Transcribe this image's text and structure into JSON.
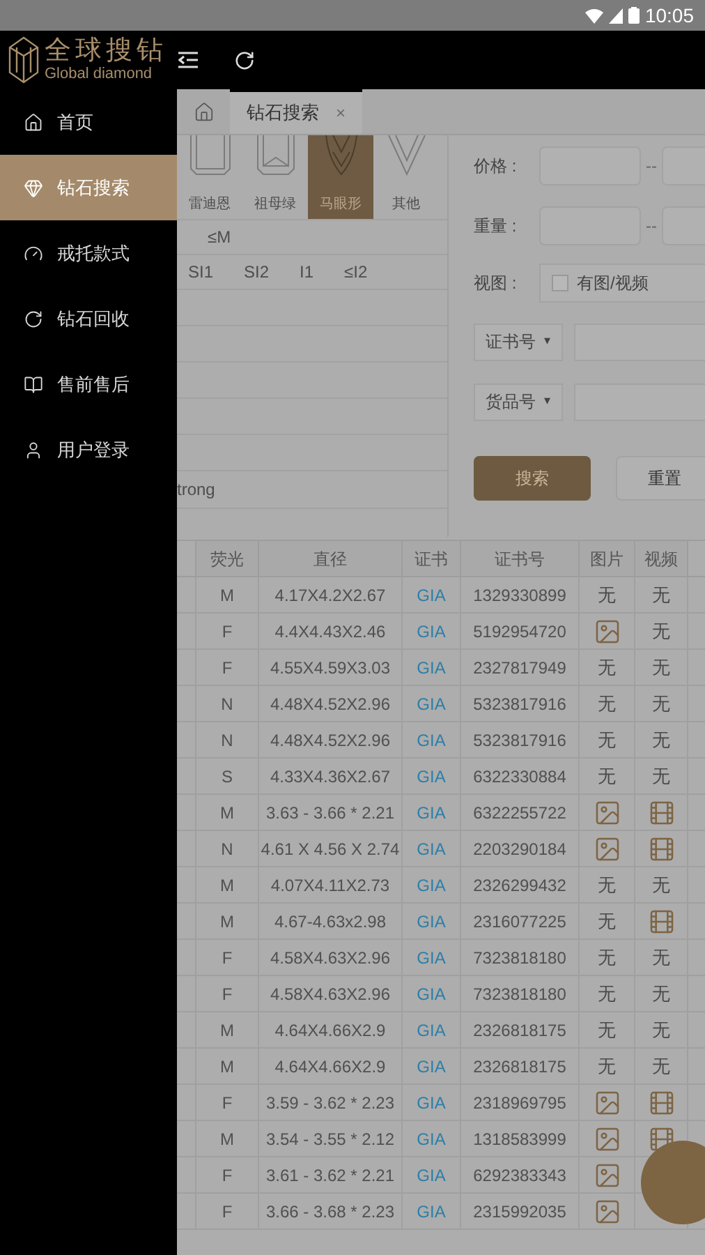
{
  "status_bar": {
    "time": "10:05"
  },
  "header": {
    "logo_title": "全球搜钻",
    "logo_subtitle": "Global diamond"
  },
  "sidebar": {
    "items": [
      {
        "label": "首页",
        "selected": false
      },
      {
        "label": "钻石搜索",
        "selected": true
      },
      {
        "label": "戒托款式",
        "selected": false
      },
      {
        "label": "钻石回收",
        "selected": false
      },
      {
        "label": "售前售后",
        "selected": false
      },
      {
        "label": "用户登录",
        "selected": false
      }
    ]
  },
  "tabs": [
    {
      "label": "钻石搜索",
      "close": "×",
      "selected": true
    }
  ],
  "filters": {
    "shapes": [
      {
        "label": "雷迪恩",
        "selected": false
      },
      {
        "label": "祖母绿",
        "selected": false
      },
      {
        "label": "马眼形",
        "selected": true
      },
      {
        "label": "其他",
        "selected": false
      }
    ],
    "rows": [
      {
        "kind": "options",
        "options": [
          "≤M"
        ]
      },
      {
        "kind": "options",
        "options": [
          "SI1",
          "SI2",
          "I1",
          "≤I2"
        ]
      },
      {
        "kind": "empty"
      },
      {
        "kind": "empty"
      },
      {
        "kind": "empty"
      },
      {
        "kind": "empty"
      },
      {
        "kind": "empty"
      },
      {
        "kind": "text",
        "text": "trong"
      }
    ]
  },
  "form": {
    "price": {
      "label": "价格 :",
      "separator": "--"
    },
    "weight": {
      "label": "重量 :",
      "separator": "--"
    },
    "view": {
      "label": "视图 :",
      "checkbox_label": "有图/视频",
      "checked": false
    },
    "selects": [
      {
        "label": "证书号",
        "caret": "▾"
      },
      {
        "label": "货品号",
        "caret": "▾"
      }
    ],
    "search_button": "搜索",
    "reset_button": "重置"
  },
  "table": {
    "columns": [
      "荧光",
      "直径",
      "证书",
      "证书号",
      "图片",
      "视频"
    ],
    "rows": [
      {
        "fluor": "M",
        "diameter": "4.17X4.2X2.67",
        "cert": "GIA",
        "cert_no": "1329330899",
        "photo": {
          "kind": "text",
          "text": "无"
        },
        "video": {
          "kind": "text",
          "text": "无"
        }
      },
      {
        "fluor": "F",
        "diameter": "4.4X4.43X2.46",
        "cert": "GIA",
        "cert_no": "5192954720",
        "photo": {
          "kind": "icon"
        },
        "video": {
          "kind": "text",
          "text": "无"
        }
      },
      {
        "fluor": "F",
        "diameter": "4.55X4.59X3.03",
        "cert": "GIA",
        "cert_no": "2327817949",
        "photo": {
          "kind": "text",
          "text": "无"
        },
        "video": {
          "kind": "text",
          "text": "无"
        }
      },
      {
        "fluor": "N",
        "diameter": "4.48X4.52X2.96",
        "cert": "GIA",
        "cert_no": "5323817916",
        "photo": {
          "kind": "text",
          "text": "无"
        },
        "video": {
          "kind": "text",
          "text": "无"
        }
      },
      {
        "fluor": "N",
        "diameter": "4.48X4.52X2.96",
        "cert": "GIA",
        "cert_no": "5323817916",
        "photo": {
          "kind": "text",
          "text": "无"
        },
        "video": {
          "kind": "text",
          "text": "无"
        }
      },
      {
        "fluor": "S",
        "diameter": "4.33X4.36X2.67",
        "cert": "GIA",
        "cert_no": "6322330884",
        "photo": {
          "kind": "text",
          "text": "无"
        },
        "video": {
          "kind": "text",
          "text": "无"
        }
      },
      {
        "fluor": "M",
        "diameter": "3.63 - 3.66 * 2.21",
        "cert": "GIA",
        "cert_no": "6322255722",
        "photo": {
          "kind": "icon"
        },
        "video": {
          "kind": "icon"
        }
      },
      {
        "fluor": "N",
        "diameter": "4.61 X 4.56 X 2.74",
        "cert": "GIA",
        "cert_no": "2203290184",
        "photo": {
          "kind": "icon"
        },
        "video": {
          "kind": "icon"
        }
      },
      {
        "fluor": "M",
        "diameter": "4.07X4.11X2.73",
        "cert": "GIA",
        "cert_no": "2326299432",
        "photo": {
          "kind": "text",
          "text": "无"
        },
        "video": {
          "kind": "text",
          "text": "无"
        }
      },
      {
        "fluor": "M",
        "diameter": "4.67-4.63x2.98",
        "cert": "GIA",
        "cert_no": "2316077225",
        "photo": {
          "kind": "text",
          "text": "无"
        },
        "video": {
          "kind": "icon"
        }
      },
      {
        "fluor": "F",
        "diameter": "4.58X4.63X2.96",
        "cert": "GIA",
        "cert_no": "7323818180",
        "photo": {
          "kind": "text",
          "text": "无"
        },
        "video": {
          "kind": "text",
          "text": "无"
        }
      },
      {
        "fluor": "F",
        "diameter": "4.58X4.63X2.96",
        "cert": "GIA",
        "cert_no": "7323818180",
        "photo": {
          "kind": "text",
          "text": "无"
        },
        "video": {
          "kind": "text",
          "text": "无"
        }
      },
      {
        "fluor": "M",
        "diameter": "4.64X4.66X2.9",
        "cert": "GIA",
        "cert_no": "2326818175",
        "photo": {
          "kind": "text",
          "text": "无"
        },
        "video": {
          "kind": "text",
          "text": "无"
        }
      },
      {
        "fluor": "M",
        "diameter": "4.64X4.66X2.9",
        "cert": "GIA",
        "cert_no": "2326818175",
        "photo": {
          "kind": "text",
          "text": "无"
        },
        "video": {
          "kind": "text",
          "text": "无"
        }
      },
      {
        "fluor": "F",
        "diameter": "3.59 - 3.62 * 2.23",
        "cert": "GIA",
        "cert_no": "2318969795",
        "photo": {
          "kind": "icon"
        },
        "video": {
          "kind": "icon"
        }
      },
      {
        "fluor": "M",
        "diameter": "3.54 - 3.55 * 2.12",
        "cert": "GIA",
        "cert_no": "1318583999",
        "photo": {
          "kind": "icon"
        },
        "video": {
          "kind": "icon"
        }
      },
      {
        "fluor": "F",
        "diameter": "3.61 - 3.62 * 2.21",
        "cert": "GIA",
        "cert_no": "6292383343",
        "photo": {
          "kind": "icon"
        },
        "video": {
          "kind": "hidden"
        }
      },
      {
        "fluor": "F",
        "diameter": "3.66 - 3.68 * 2.23",
        "cert": "GIA",
        "cert_no": "2315992035",
        "photo": {
          "kind": "icon"
        },
        "video": {
          "kind": "hidden"
        }
      }
    ]
  }
}
